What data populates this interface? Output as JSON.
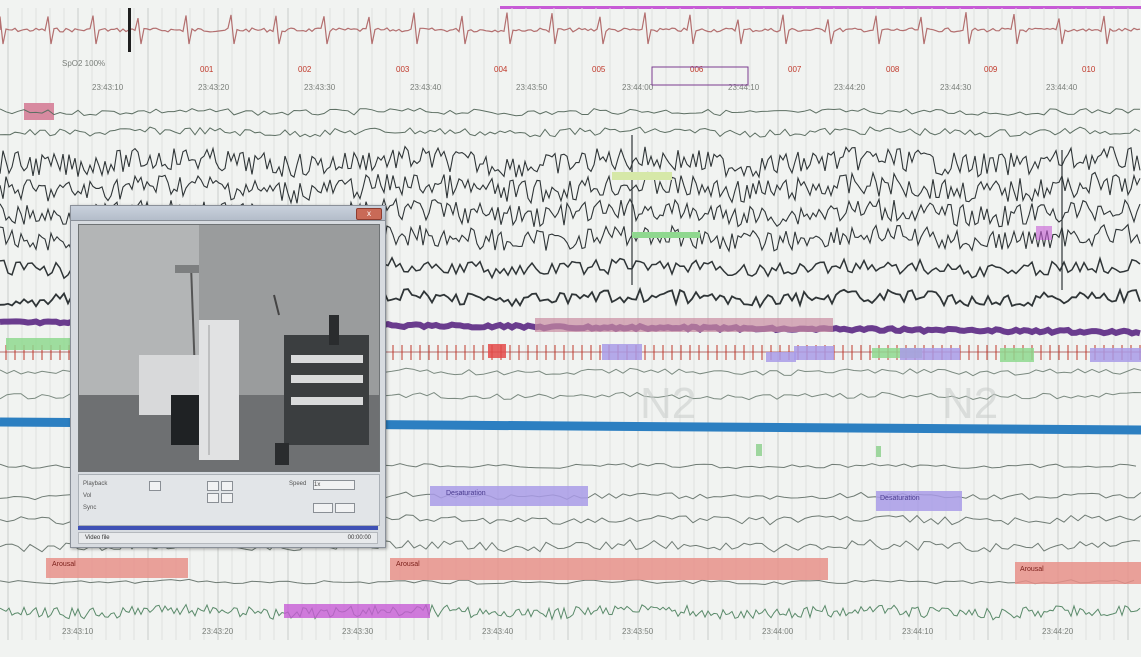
{
  "header": {
    "spo2_label": "SpO2 100%",
    "epoch_numbers": [
      "001",
      "002",
      "003",
      "004",
      "005",
      "006",
      "007",
      "008",
      "009",
      "010"
    ],
    "timestamps": [
      "23:43:10",
      "23:43:20",
      "23:43:30",
      "23:43:40",
      "23:43:50",
      "23:44:00",
      "23:44:10",
      "23:44:20",
      "23:44:30",
      "23:44:40"
    ]
  },
  "scoring": {
    "stage_label": "N2"
  },
  "events": {
    "desat_label": "Desaturation",
    "arousal_label": "Arousal"
  },
  "video": {
    "close_label": "x",
    "playback_label": "Playback",
    "speed_label": "Speed",
    "speed_value": "1x",
    "volume_label": "Vol",
    "sync_label": "Sync",
    "status_left": "Video file",
    "status_right": "00:00:00"
  },
  "colors": {
    "eeg": "#2f3537",
    "purple_band": "#6a3c8e",
    "blue_band": "#2c7fc1",
    "dark_blue": "#2746a8",
    "salmon": "#e7908a",
    "lavender": "#a99be8",
    "pink_bar": "#c98ba1",
    "green_bar": "#8fd88f",
    "red_mark": "#e44a4a",
    "magenta": "#c75bd6"
  }
}
